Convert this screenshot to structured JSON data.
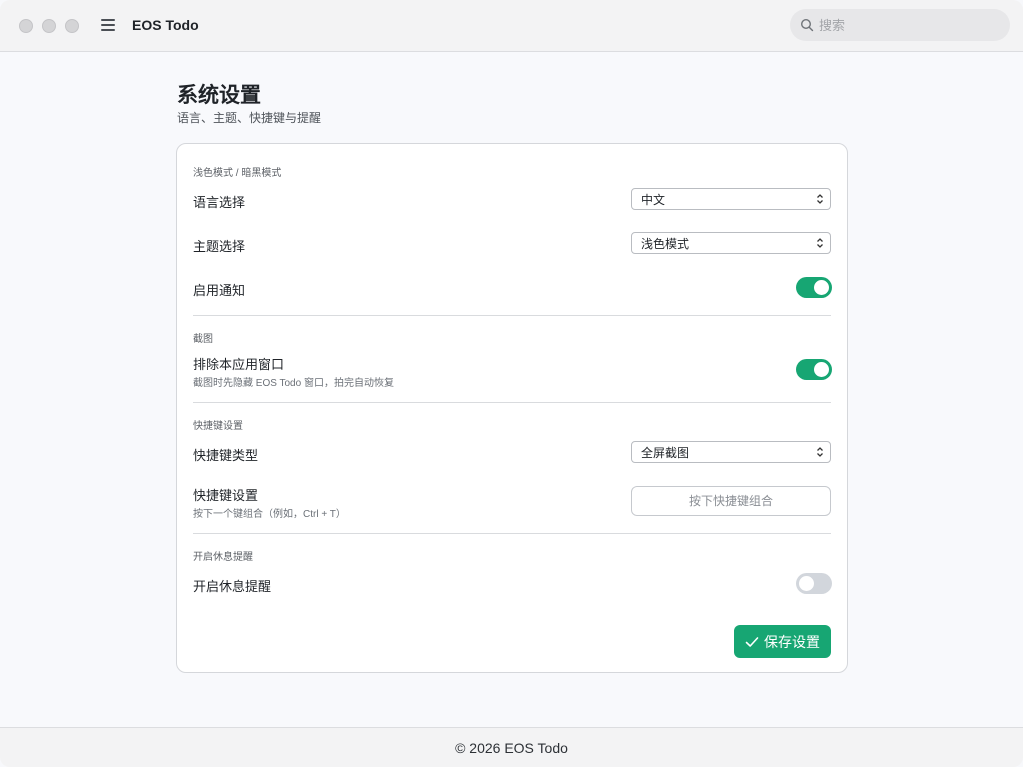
{
  "app": {
    "title": "EOS Todo"
  },
  "search": {
    "placeholder": "搜索"
  },
  "page": {
    "title": "系统设置",
    "subtitle": "语言、主题、快捷键与提醒"
  },
  "sections": {
    "appearance": {
      "label": "浅色模式 / 暗黑模式",
      "language": {
        "label": "语言选择",
        "value": "中文"
      },
      "theme": {
        "label": "主题选择",
        "value": "浅色模式"
      },
      "notify": {
        "label": "启用通知",
        "enabled": true
      }
    },
    "screenshot": {
      "label": "截图",
      "exclude": {
        "label": "排除本应用窗口",
        "desc": "截图时先隐藏 EOS Todo 窗口，拍完自动恢复",
        "enabled": true
      }
    },
    "hotkey": {
      "label": "快捷键设置",
      "type": {
        "label": "快捷键类型",
        "value": "全屏截图"
      },
      "setting": {
        "label": "快捷键设置",
        "desc": "按下一个键组合（例如，Ctrl + T）",
        "placeholder": "按下快捷键组合"
      }
    },
    "rest": {
      "label": "开启休息提醒",
      "toggle": {
        "label": "开启休息提醒",
        "enabled": false
      }
    }
  },
  "actions": {
    "save_label": "保存设置"
  },
  "footer": {
    "text": "© 2026 EOS Todo"
  },
  "colors": {
    "accent": "#17a673",
    "toggle_off": "#d2d6dc"
  }
}
